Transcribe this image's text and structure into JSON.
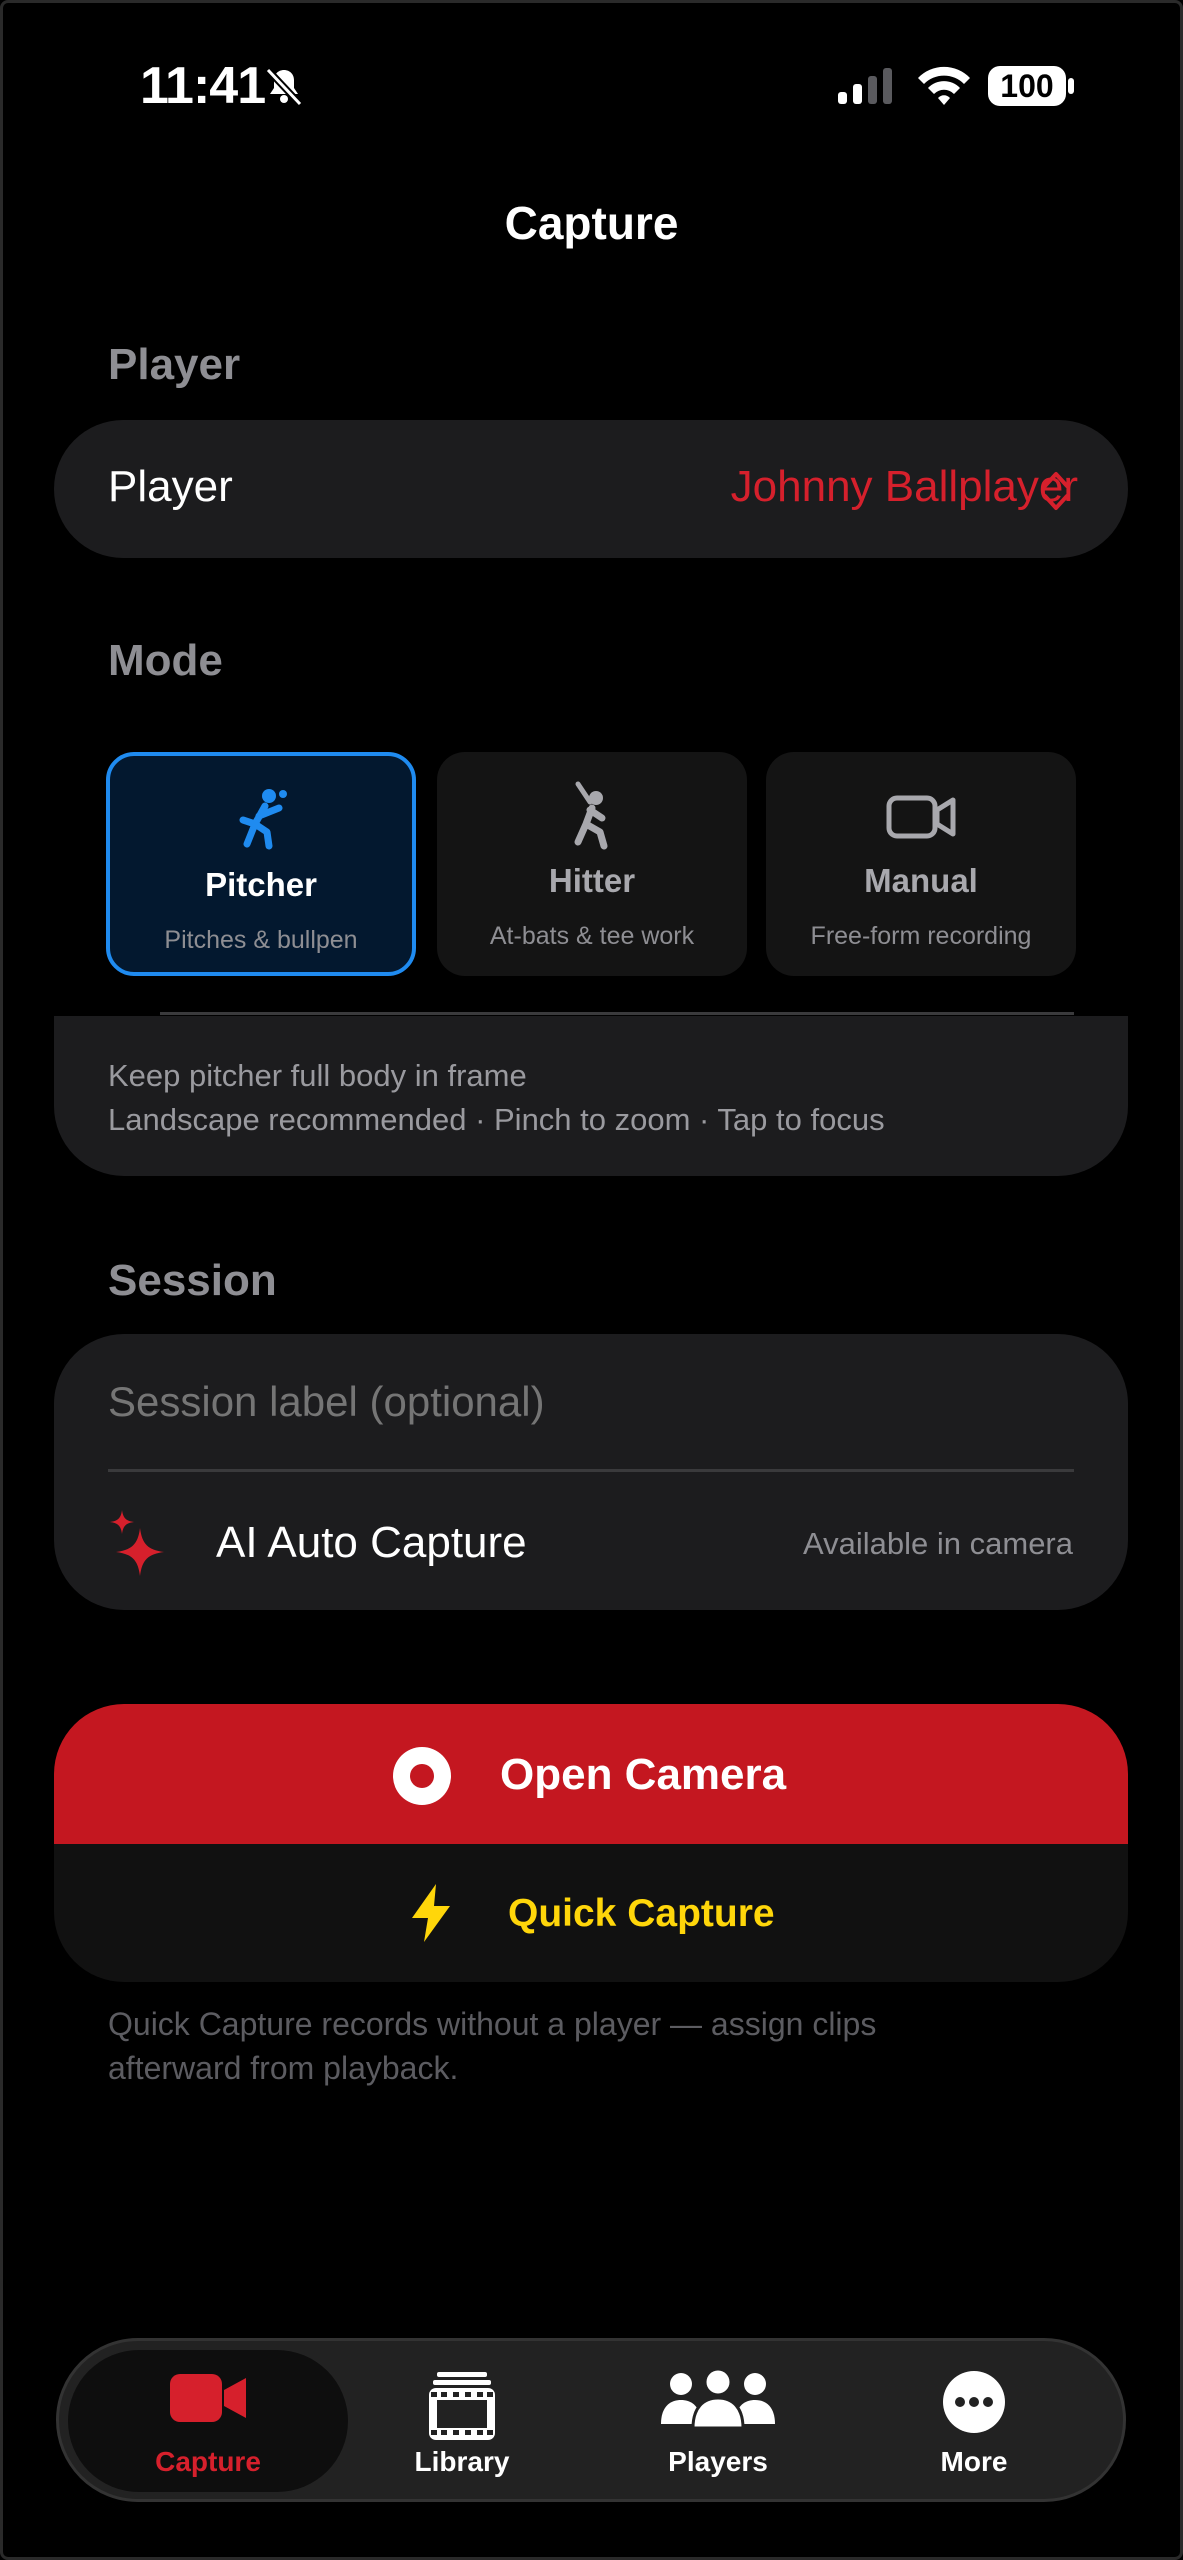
{
  "status_bar": {
    "time": "11:41",
    "battery": "100"
  },
  "header": {
    "title": "Capture"
  },
  "player_section": {
    "label": "Player",
    "row_label": "Player",
    "value": "Johnny Ballplayer"
  },
  "mode_section": {
    "label": "Mode",
    "modes": [
      {
        "title": "Pitcher",
        "subtitle": "Pitches & bullpen",
        "selected": true
      },
      {
        "title": "Hitter",
        "subtitle": "At-bats & tee work",
        "selected": false
      },
      {
        "title": "Manual",
        "subtitle": "Free-form recording",
        "selected": false
      }
    ],
    "tips": [
      "Keep pitcher full body in frame",
      "Landscape recommended · Pinch to zoom · Tap to focus"
    ]
  },
  "session_section": {
    "label": "Session",
    "placeholder": "Session label (optional)",
    "ai_label": "AI Auto Capture",
    "ai_status": "Available in camera"
  },
  "actions": {
    "open_camera": "Open Camera",
    "quick_capture": "Quick Capture",
    "note_lines": [
      "Quick Capture records without a player — assign clips",
      "afterward from playback."
    ]
  },
  "tabbar": {
    "tabs": [
      {
        "label": "Capture",
        "active": true
      },
      {
        "label": "Library",
        "active": false
      },
      {
        "label": "Players",
        "active": false
      },
      {
        "label": "More",
        "active": false
      }
    ]
  },
  "colors": {
    "accent_red": "#d6202c",
    "selected_blue": "#1f8bf0",
    "quick_yellow": "#ffd60a"
  }
}
